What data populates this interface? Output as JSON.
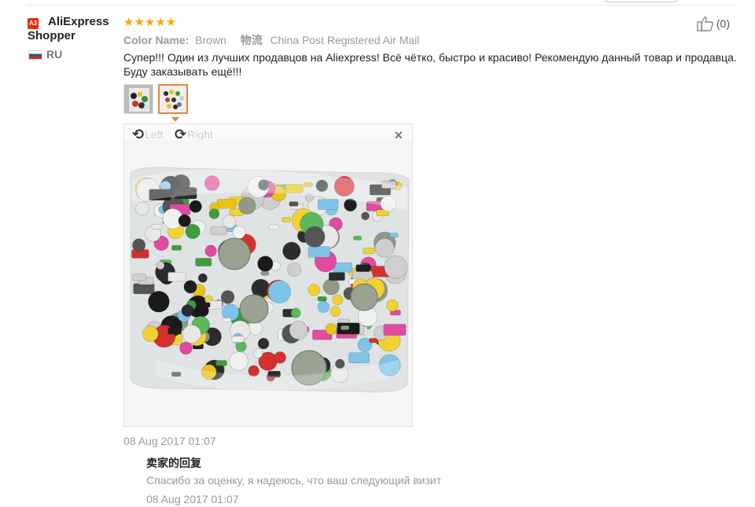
{
  "review": {
    "badge": "A3",
    "user_name": "AliExpress Shopper",
    "country": "RU",
    "stars": "★★★★★",
    "likes": "(0)",
    "color_label": "Color Name:",
    "color_value": "Brown",
    "logistics_label": "物流",
    "logistics_value": "China Post Registered Air Mail",
    "text": "Супер!!! Один из лучших продавцов на Aliexpress! Всё чётко, быстро и красиво! Рекомендую данный товар и продавца. Буду заказывать ещё!!!",
    "date": "08 Aug 2017 01:07"
  },
  "viewer": {
    "rotate_left_label": "Left",
    "rotate_right_label": "Right",
    "close_label": "×"
  },
  "seller_reply": {
    "title": "卖家的回复",
    "text": "Спасибо за оценку, я надеюсь, что ваш следующий визит",
    "date": "08 Aug 2017 01:07"
  },
  "colors": {
    "star": "#f9a800",
    "accent": "#e8853a",
    "brand": "#e62e04"
  }
}
